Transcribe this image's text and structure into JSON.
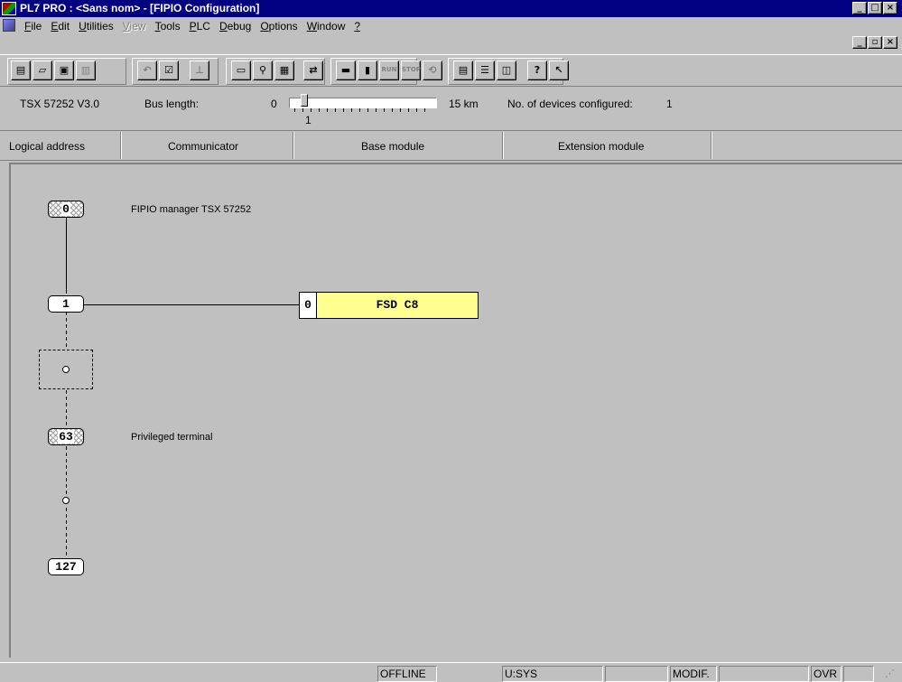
{
  "window": {
    "title": "PL7 PRO : <Sans nom> - [FIPIO Configuration]"
  },
  "menu": {
    "items": [
      {
        "label": "File",
        "enabled": true
      },
      {
        "label": "Edit",
        "enabled": true
      },
      {
        "label": "Utilities",
        "enabled": true
      },
      {
        "label": "View",
        "enabled": false
      },
      {
        "label": "Tools",
        "enabled": true
      },
      {
        "label": "PLC",
        "enabled": true
      },
      {
        "label": "Debug",
        "enabled": true
      },
      {
        "label": "Options",
        "enabled": true
      },
      {
        "label": "Window",
        "enabled": true
      },
      {
        "label": "?",
        "enabled": true
      }
    ]
  },
  "toolbar": {
    "icons": [
      "new-icon",
      "open-icon",
      "save-icon",
      "print-icon",
      "undo-icon",
      "validate-icon",
      "export-icon",
      "screen-icon",
      "find-icon",
      "window-icon",
      "transfer-icon",
      "monitor-icon",
      "module-icon",
      "run-icon",
      "stop-icon",
      "init-icon",
      "tile-icon",
      "split-h-icon",
      "split-v-icon",
      "help-icon",
      "context-help-icon"
    ],
    "run_label": "RUN",
    "stop_label": "STOP"
  },
  "info": {
    "plc": "TSX 57252  V3.0",
    "bus_length_label": "Bus length:",
    "bus_min": "0",
    "bus_max": "15 km",
    "bus_value": "1",
    "devices_label": "No. of devices configured:",
    "devices_count": "1"
  },
  "columns": {
    "logical_address": "Logical address",
    "communicator": "Communicator",
    "base_module": "Base module",
    "extension_module": "Extension module"
  },
  "diagram": {
    "nodes": {
      "manager": "0",
      "device": "1",
      "terminal": "63",
      "last": "127"
    },
    "manager_label": "FIPIO manager  TSX 57252",
    "terminal_label": "Privileged terminal",
    "module": {
      "slot": "0",
      "name": "FSD  C8"
    },
    "colors": {
      "module_fill": "#ffff90"
    }
  },
  "status": {
    "mode": "OFFLINE",
    "user": "U:SYS",
    "modif": "MODIF.",
    "ovr": "OVR"
  }
}
